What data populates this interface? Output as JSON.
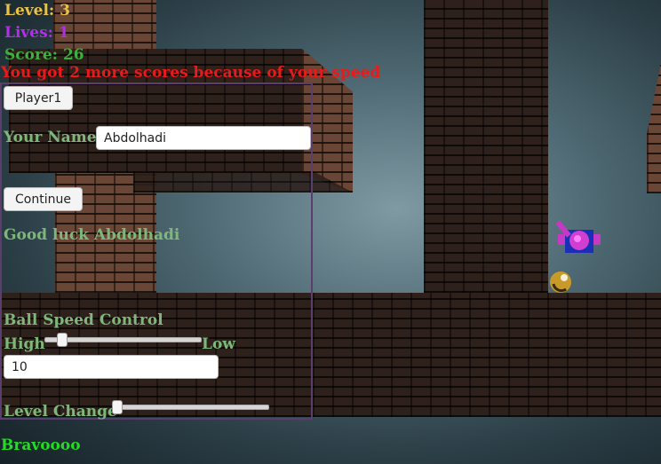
{
  "hud": {
    "level_label": "Level:",
    "level_value": "3",
    "lives_label": "Lives:",
    "lives_value": "1",
    "score_label": "Score:",
    "score_value": "26",
    "speed_message": "You got 2 more scores because of your speed"
  },
  "panel": {
    "player_button": "Player1",
    "name_label": "Your Name",
    "name_value": "Abdolhadi",
    "continue_button": "Continue",
    "good_luck": "Good luck Abdolhadi",
    "speed_control_label": "Ball Speed Control",
    "speed_high": "High",
    "speed_low": "Low",
    "speed_slider_value": 0.1,
    "speed_input_value": "10",
    "level_change_label": "Level Change",
    "level_slider_value": 0.0
  },
  "footer": {
    "message": "Bravoooo"
  },
  "colors": {
    "level": "#e8c24a",
    "lives": "#b22ee8",
    "score": "#3db13d",
    "message": "#e81a1a",
    "label": "#7fb77a",
    "bravo": "#22dd22"
  }
}
